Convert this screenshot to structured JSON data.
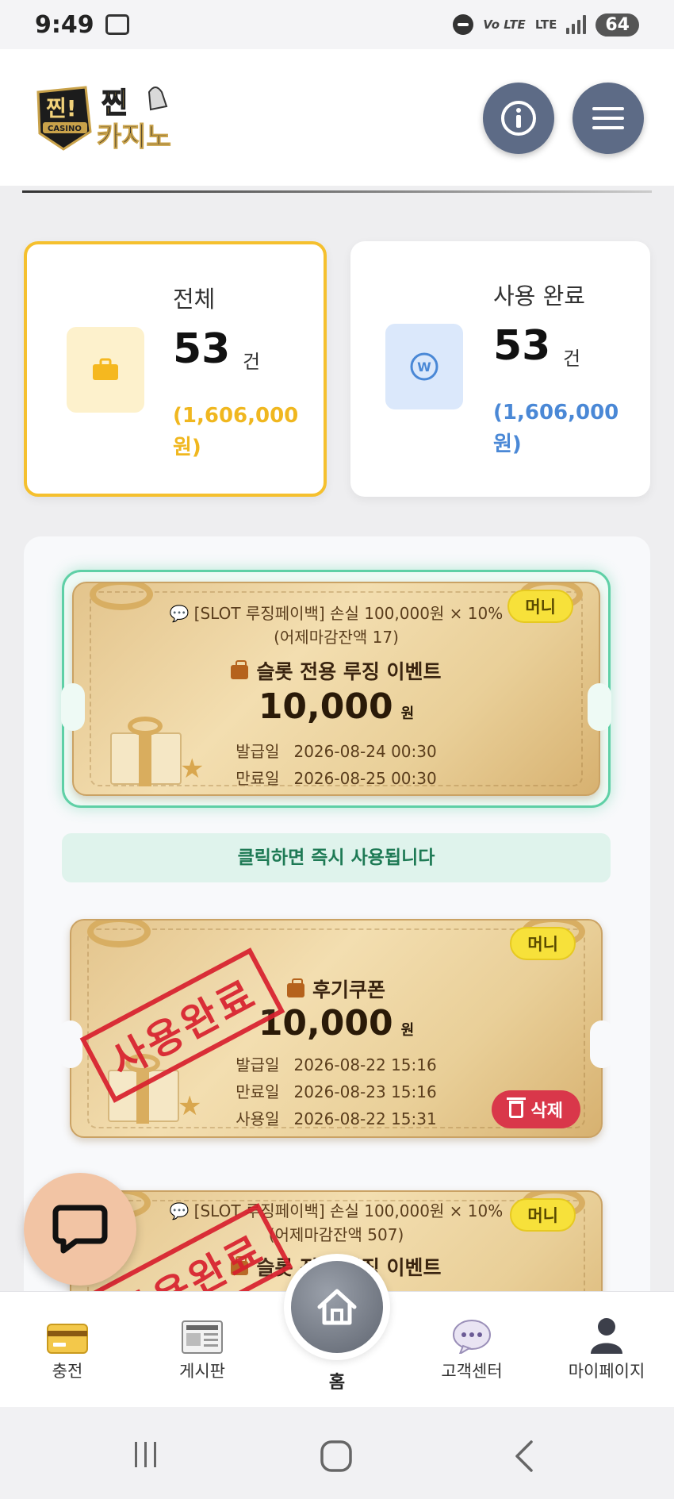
{
  "status_bar": {
    "time": "9:49",
    "battery": "64",
    "network": "LTE"
  },
  "header": {
    "logo_text_1": "찐!",
    "logo_text_2": "찐",
    "logo_text_3": "카지노",
    "logo_badge": "CASINO"
  },
  "summary": {
    "total": {
      "label": "전체",
      "count": "53",
      "unit": "건",
      "amount": "(1,606,000 원)",
      "accent": "#f5c02e"
    },
    "used": {
      "label": "사용 완료",
      "count": "53",
      "unit": "건",
      "amount": "(1,606,000 원)",
      "accent": "#4a88d6"
    }
  },
  "coupons": [
    {
      "badge": "머니",
      "description": "[SLOT 루징페이백] 손실 100,000원 × 10%",
      "sub_description": "(어제마감잔액 17)",
      "title": "슬롯 전용 루징 이벤트",
      "amount": "10,000",
      "currency": "원",
      "issued_label": "발급일",
      "issued": "2026-08-24 00:30",
      "expires_label": "만료일",
      "expires": "2026-08-25 00:30",
      "hint": "클릭하면 즉시 사용됩니다"
    },
    {
      "badge": "머니",
      "stamp": "사용완료",
      "title": "후기쿠폰",
      "amount": "10,000",
      "currency": "원",
      "issued_label": "발급일",
      "issued": "2026-08-22 15:16",
      "expires_label": "만료일",
      "expires": "2026-08-23 15:16",
      "used_label": "사용일",
      "used": "2026-08-22 15:31",
      "delete_label": "삭제"
    },
    {
      "badge": "머니",
      "stamp": "사용완료",
      "description": "[SLOT 루징페이백] 손실 100,000원 × 10%",
      "sub_description": "(어제마감잔액 507)",
      "title": "슬롯 전용 루징 이벤트"
    }
  ],
  "bottom_nav": {
    "items": [
      {
        "label": "충전",
        "icon": "credit-card-icon"
      },
      {
        "label": "게시판",
        "icon": "newspaper-icon"
      },
      {
        "label": "홈",
        "icon": "home-icon"
      },
      {
        "label": "고객센터",
        "icon": "chat-bubble-icon"
      },
      {
        "label": "마이페이지",
        "icon": "user-icon"
      }
    ]
  }
}
